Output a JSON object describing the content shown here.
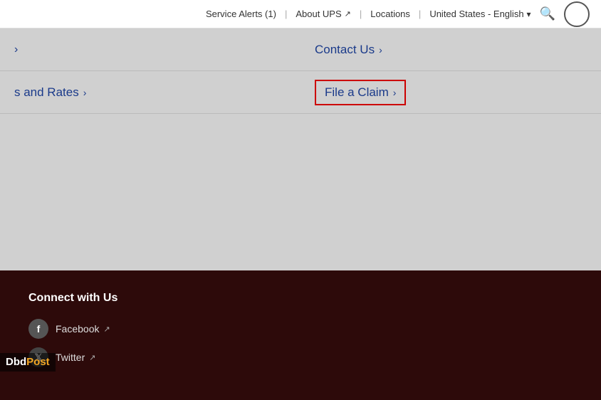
{
  "topnav": {
    "service_alerts": "Service Alerts (1)",
    "about_ups": "About UPS",
    "locations": "Locations",
    "language": "United States - English",
    "separators": [
      "|",
      "|",
      "|"
    ]
  },
  "menu": {
    "row1_left_chevron": "›",
    "contact_us": "Contact Us",
    "contact_us_chevron": "›",
    "row2_left": "s and Rates",
    "row2_left_chevron": "›",
    "file_a_claim": "File a Claim",
    "file_a_claim_chevron": "›"
  },
  "footer": {
    "connect_title": "Connect with Us",
    "facebook_label": "Facebook",
    "twitter_label": "Twitter",
    "ext_icon": "↗"
  },
  "watermark": {
    "dbd": "Dbd",
    "post": "Post"
  }
}
